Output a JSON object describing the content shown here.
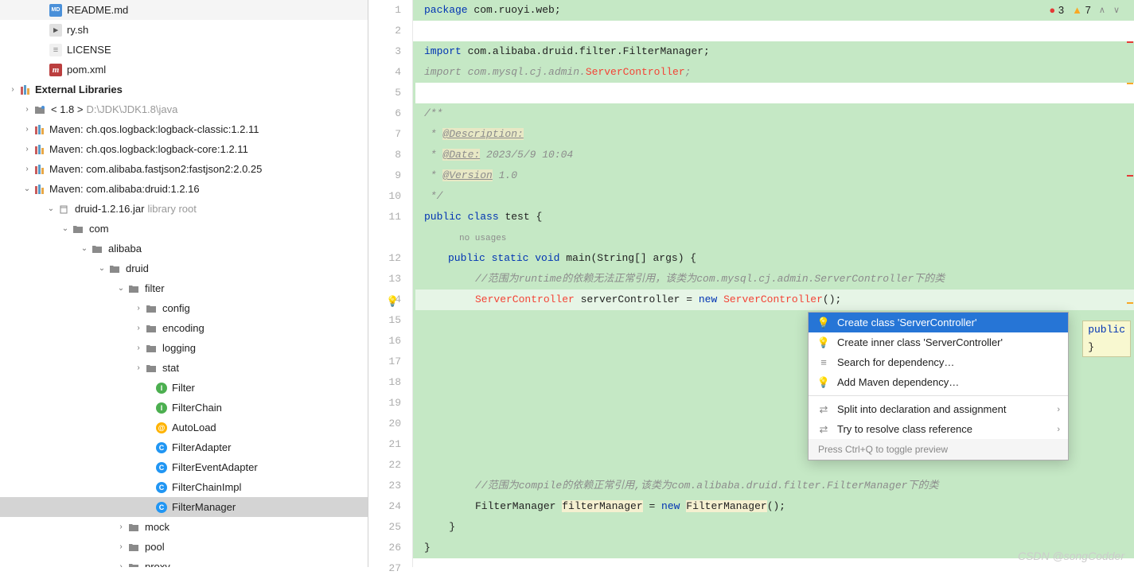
{
  "tree": [
    {
      "indent": 38,
      "icon": "md",
      "label": "README.md"
    },
    {
      "indent": 38,
      "icon": "sh",
      "label": "ry.sh"
    },
    {
      "indent": 38,
      "icon": "file",
      "label": "LICENSE"
    },
    {
      "indent": 38,
      "icon": "m",
      "label": "pom.xml"
    },
    {
      "indent": 0,
      "arrow": "right",
      "icon": "libs",
      "label": "External Libraries",
      "bold": true
    },
    {
      "indent": 18,
      "arrow": "right",
      "icon": "folder-dot",
      "label": "< 1.8 >",
      "hint": "D:\\JDK\\JDK1.8\\java"
    },
    {
      "indent": 18,
      "arrow": "right",
      "icon": "libs",
      "label": "Maven: ch.qos.logback:logback-classic:1.2.11"
    },
    {
      "indent": 18,
      "arrow": "right",
      "icon": "libs",
      "label": "Maven: ch.qos.logback:logback-core:1.2.11"
    },
    {
      "indent": 18,
      "arrow": "right",
      "icon": "libs",
      "label": "Maven: com.alibaba.fastjson2:fastjson2:2.0.25"
    },
    {
      "indent": 18,
      "arrow": "down",
      "icon": "libs",
      "label": "Maven: com.alibaba:druid:1.2.16"
    },
    {
      "indent": 48,
      "arrow": "down",
      "icon": "jar",
      "label": "druid-1.2.16.jar",
      "hint": "library root"
    },
    {
      "indent": 66,
      "arrow": "down",
      "icon": "folder",
      "label": "com"
    },
    {
      "indent": 90,
      "arrow": "down",
      "icon": "folder",
      "label": "alibaba"
    },
    {
      "indent": 112,
      "arrow": "down",
      "icon": "folder",
      "label": "druid"
    },
    {
      "indent": 136,
      "arrow": "down",
      "icon": "folder",
      "label": "filter"
    },
    {
      "indent": 158,
      "arrow": "right",
      "icon": "folder",
      "label": "config"
    },
    {
      "indent": 158,
      "arrow": "right",
      "icon": "folder",
      "label": "encoding"
    },
    {
      "indent": 158,
      "arrow": "right",
      "icon": "folder",
      "label": "logging"
    },
    {
      "indent": 158,
      "arrow": "right",
      "icon": "folder",
      "label": "stat"
    },
    {
      "indent": 172,
      "icon": "class-i",
      "label": "Filter"
    },
    {
      "indent": 172,
      "icon": "class-i",
      "label": "FilterChain"
    },
    {
      "indent": 172,
      "icon": "class-a",
      "label": "AutoLoad"
    },
    {
      "indent": 172,
      "icon": "class-c",
      "label": "FilterAdapter"
    },
    {
      "indent": 172,
      "icon": "class-c",
      "label": "FilterEventAdapter"
    },
    {
      "indent": 172,
      "icon": "class-c",
      "label": "FilterChainImpl"
    },
    {
      "indent": 172,
      "icon": "class-c",
      "label": "FilterManager",
      "selected": true
    },
    {
      "indent": 136,
      "arrow": "right",
      "icon": "folder",
      "label": "mock"
    },
    {
      "indent": 136,
      "arrow": "right",
      "icon": "folder",
      "label": "pool"
    },
    {
      "indent": 136,
      "arrow": "right",
      "icon": "folder",
      "label": "proxy"
    }
  ],
  "lines": [
    1,
    2,
    3,
    4,
    5,
    6,
    7,
    8,
    9,
    10,
    11,
    12,
    13,
    14,
    15,
    16,
    17,
    18,
    19,
    20,
    21,
    22,
    23,
    24,
    25,
    26,
    27
  ],
  "code": {
    "l1_kw": "package",
    "l1_pkg": " com.ruoyi.web;",
    "l3_kw": "import",
    "l3_pkg": " com.alibaba.druid.filter.FilterManager;",
    "l4_kw": "import",
    "l4_pkg": " com.mysql.cj.admin.",
    "l4_err": "ServerController",
    "l4_end": ";",
    "l6": "/**",
    "l7_pre": " * ",
    "l7_tag": "@Description:",
    "l8_pre": " * ",
    "l8_tag": "@Date:",
    "l8_txt": " 2023/5/9 10:04",
    "l9_pre": " * ",
    "l9_tag": "@Version",
    "l9_txt": " 1.0",
    "l10": " */",
    "l11_a": "public",
    "l11_b": "class",
    "l11_c": "test {",
    "usage": "no usages",
    "l12_a": "public",
    "l12_b": "static",
    "l12_c": "void",
    "l12_d": "main",
    "l12_e": "(String[] args) {",
    "l13": "//范围为runtime的依赖无法正常引用，该类为com.mysql.cj.admin.ServerController下的类",
    "l14_a": "ServerController",
    "l14_b": " serverController = ",
    "l14_c": "new",
    "l14_d": "ServerController",
    "l14_e": "();",
    "l23": "//范围为compile的依赖正常引用,该类为com.alibaba.druid.filter.FilterManager下的类",
    "l24_a": "FilterManager ",
    "l24_b": "filterManager",
    "l24_c": " = ",
    "l24_d": "new",
    "l24_e": "FilterManager",
    "l24_f": "();",
    "l25": "    }",
    "l26": "}"
  },
  "popup": {
    "items": [
      {
        "icon": "bulb-red",
        "label": "Create class 'ServerController'",
        "selected": true
      },
      {
        "icon": "bulb-red",
        "label": "Create inner class 'ServerController'"
      },
      {
        "icon": "stack",
        "label": "Search for dependency…"
      },
      {
        "icon": "bulb-red",
        "label": "Add Maven dependency…"
      },
      {
        "divider": true
      },
      {
        "icon": "split",
        "label": "Split into declaration and assignment",
        "chevron": true
      },
      {
        "icon": "split",
        "label": "Try to resolve class reference",
        "chevron": true
      }
    ],
    "footer": "Press Ctrl+Q to toggle preview"
  },
  "badges": {
    "errors": "3",
    "warnings": "7"
  },
  "hint": {
    "l1": "public",
    "l2": "}"
  },
  "watermark": "CSDN @songCodder"
}
